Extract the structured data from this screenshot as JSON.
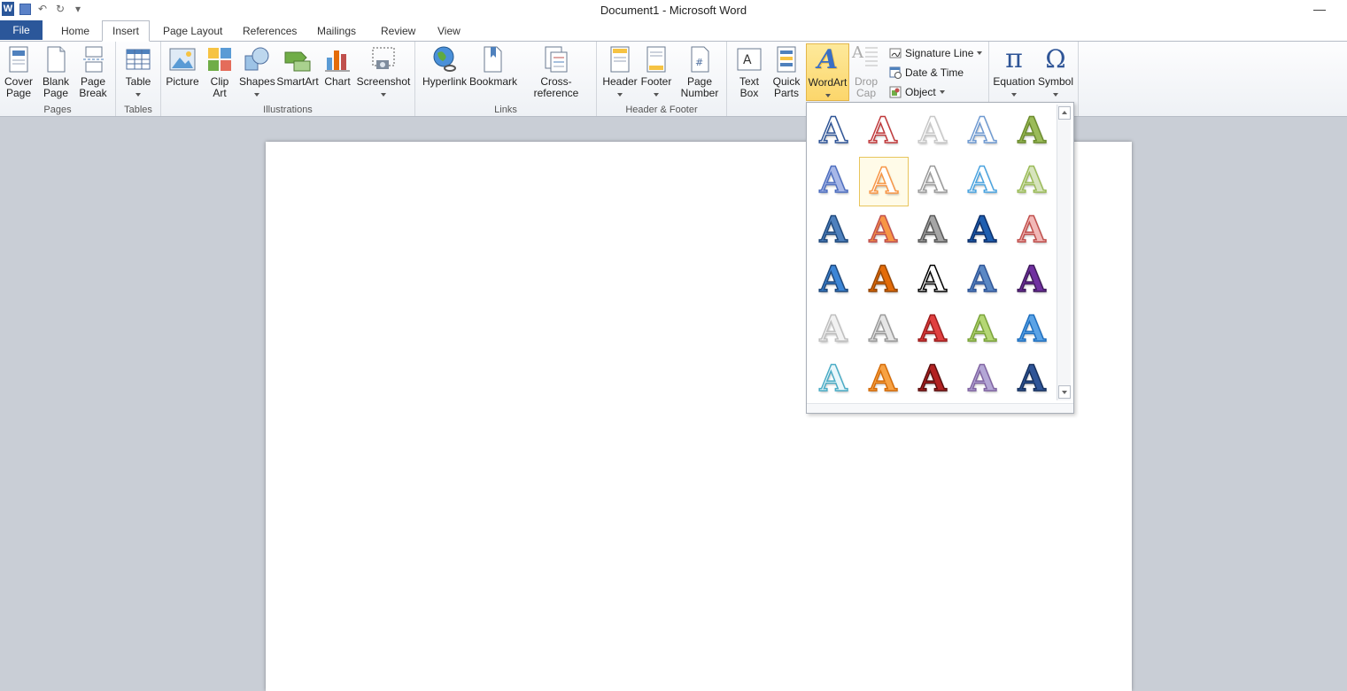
{
  "window": {
    "title": "Document1  -  Microsoft Word",
    "minimize_glyph": "—"
  },
  "qat": {
    "app_letter": "W",
    "undo_glyph": "↶",
    "redo_glyph": "↻",
    "menu_glyph": "▾"
  },
  "tabs": [
    "File",
    "Home",
    "Insert",
    "Page Layout",
    "References",
    "Mailings",
    "Review",
    "View"
  ],
  "active_tab": "Insert",
  "ribbon": {
    "groups": {
      "pages": "Pages",
      "tables": "Tables",
      "illustrations": "Illustrations",
      "links": "Links",
      "header_footer": "Header & Footer"
    },
    "buttons": {
      "cover_page": [
        "Cover",
        "Page"
      ],
      "blank_page": [
        "Blank",
        "Page"
      ],
      "page_break": [
        "Page",
        "Break"
      ],
      "table": [
        "Table",
        ""
      ],
      "picture": [
        "Picture",
        ""
      ],
      "clip_art": [
        "Clip",
        "Art"
      ],
      "shapes": [
        "Shapes",
        ""
      ],
      "smartart": [
        "SmartArt",
        ""
      ],
      "chart": [
        "Chart",
        ""
      ],
      "screenshot": [
        "Screenshot",
        ""
      ],
      "hyperlink": [
        "Hyperlink",
        ""
      ],
      "bookmark": [
        "Bookmark",
        ""
      ],
      "cross_reference": [
        "Cross-reference",
        ""
      ],
      "header": [
        "Header",
        ""
      ],
      "footer": [
        "Footer",
        ""
      ],
      "page_number": [
        "Page",
        "Number"
      ],
      "text_box": [
        "Text",
        "Box"
      ],
      "quick_parts": [
        "Quick",
        "Parts"
      ],
      "wordart": [
        "WordArt",
        ""
      ],
      "drop_cap": [
        "Drop",
        "Cap"
      ],
      "equation": [
        "Equation",
        ""
      ],
      "symbol": [
        "Symbol",
        ""
      ]
    },
    "small": {
      "signature_line": "Signature Line",
      "date_time": "Date & Time",
      "object": "Object"
    },
    "glyphs": {
      "equation": "π",
      "symbol": "Ω",
      "wordart": "A",
      "dropcap": "A"
    }
  },
  "wordart_gallery": {
    "glyph": "A",
    "selected_index": 6,
    "styles": [
      {
        "fill": "#ffffff",
        "stroke": "#2f5597"
      },
      {
        "fill": "#ffffff",
        "stroke": "#c0393b"
      },
      {
        "fill": "#ffffff",
        "stroke": "#c8c8c8"
      },
      {
        "fill": "#ffffff",
        "stroke": "#6f9ad1"
      },
      {
        "fill": "#9bbb59",
        "stroke": "#6c8c2e"
      },
      {
        "fill": "#a8b8e8",
        "stroke": "#4f6fbf"
      },
      {
        "fill": "#ffffff",
        "stroke": "#f79646"
      },
      {
        "fill": "#ffffff",
        "stroke": "#9a9a9a"
      },
      {
        "fill": "#ffffff",
        "stroke": "#4aa3df"
      },
      {
        "fill": "#d7e4bd",
        "stroke": "#9bbb59"
      },
      {
        "fill": "#4f81bd",
        "stroke": "#1f497d"
      },
      {
        "fill": "#f79646",
        "stroke": "#c0504d"
      },
      {
        "fill": "#a6a6a6",
        "stroke": "#595959"
      },
      {
        "fill": "#1f5fb0",
        "stroke": "#0b2f6b"
      },
      {
        "fill": "#f2b8b7",
        "stroke": "#c0504d"
      },
      {
        "fill": "#3d86d6",
        "stroke": "#1f497d"
      },
      {
        "fill": "#e36c09",
        "stroke": "#974706"
      },
      {
        "fill": "#ffffff",
        "stroke": "#000000"
      },
      {
        "fill": "#5b88c4",
        "stroke": "#2f5597"
      },
      {
        "fill": "#7030a0",
        "stroke": "#3f1a5c"
      },
      {
        "fill": "#f2f2f2",
        "stroke": "#bfbfbf"
      },
      {
        "fill": "#e6e6e6",
        "stroke": "#9a9a9a"
      },
      {
        "fill": "#e04040",
        "stroke": "#9c1c1c"
      },
      {
        "fill": "#b5d775",
        "stroke": "#7aa33a"
      },
      {
        "fill": "#5ba3e6",
        "stroke": "#1f6fbf"
      },
      {
        "fill": "#e9f7fb",
        "stroke": "#4bacc6"
      },
      {
        "fill": "#f7a244",
        "stroke": "#d46b08"
      },
      {
        "fill": "#b22222",
        "stroke": "#5c0e0e"
      },
      {
        "fill": "#b4a7d6",
        "stroke": "#8064a2"
      },
      {
        "fill": "#2f5597",
        "stroke": "#15305e"
      }
    ]
  }
}
